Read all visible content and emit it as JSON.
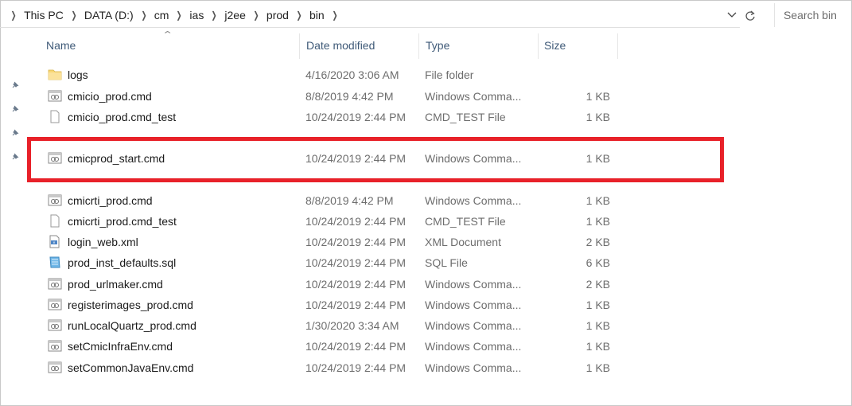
{
  "breadcrumb": [
    "This PC",
    "DATA (D:)",
    "cm",
    "ias",
    "j2ee",
    "prod",
    "bin"
  ],
  "search": {
    "placeholder": "Search bin"
  },
  "columns": {
    "name": "Name",
    "date": "Date modified",
    "type": "Type",
    "size": "Size"
  },
  "files": [
    {
      "name": "logs",
      "date": "4/16/2020 3:06 AM",
      "type": "File folder",
      "size": "",
      "icon": "folder-icon"
    },
    {
      "name": "cmicio_prod.cmd",
      "date": "8/8/2019 4:42 PM",
      "type": "Windows Comma...",
      "size": "1 KB",
      "icon": "cmd-file-icon"
    },
    {
      "name": "cmicio_prod.cmd_test",
      "date": "10/24/2019 2:44 PM",
      "type": "CMD_TEST File",
      "size": "1 KB",
      "icon": "blank-file-icon"
    },
    {
      "name": "cmicprod_start.cmd",
      "date": "10/24/2019 2:44 PM",
      "type": "Windows Comma...",
      "size": "1 KB",
      "icon": "cmd-file-icon"
    },
    {
      "name": "cmicrti_prod.cmd",
      "date": "8/8/2019 4:42 PM",
      "type": "Windows Comma...",
      "size": "1 KB",
      "icon": "cmd-file-icon"
    },
    {
      "name": "cmicrti_prod.cmd_test",
      "date": "10/24/2019 2:44 PM",
      "type": "CMD_TEST File",
      "size": "1 KB",
      "icon": "blank-file-icon"
    },
    {
      "name": "login_web.xml",
      "date": "10/24/2019 2:44 PM",
      "type": "XML Document",
      "size": "2 KB",
      "icon": "xml-file-icon"
    },
    {
      "name": "prod_inst_defaults.sql",
      "date": "10/24/2019 2:44 PM",
      "type": "SQL File",
      "size": "6 KB",
      "icon": "sql-file-icon"
    },
    {
      "name": "prod_urlmaker.cmd",
      "date": "10/24/2019 2:44 PM",
      "type": "Windows Comma...",
      "size": "2 KB",
      "icon": "cmd-file-icon"
    },
    {
      "name": "registerimages_prod.cmd",
      "date": "10/24/2019 2:44 PM",
      "type": "Windows Comma...",
      "size": "1 KB",
      "icon": "cmd-file-icon"
    },
    {
      "name": "runLocalQuartz_prod.cmd",
      "date": "1/30/2020 3:34 AM",
      "type": "Windows Comma...",
      "size": "1 KB",
      "icon": "cmd-file-icon"
    },
    {
      "name": "setCmicInfraEnv.cmd",
      "date": "10/24/2019 2:44 PM",
      "type": "Windows Comma...",
      "size": "1 KB",
      "icon": "cmd-file-icon"
    },
    {
      "name": "setCommonJavaEnv.cmd",
      "date": "10/24/2019 2:44 PM",
      "type": "Windows Comma...",
      "size": "1 KB",
      "icon": "cmd-file-icon"
    }
  ],
  "colors": {
    "highlight_border": "#e82129",
    "header_text": "#3f5a78",
    "folder": "#f8d775"
  }
}
